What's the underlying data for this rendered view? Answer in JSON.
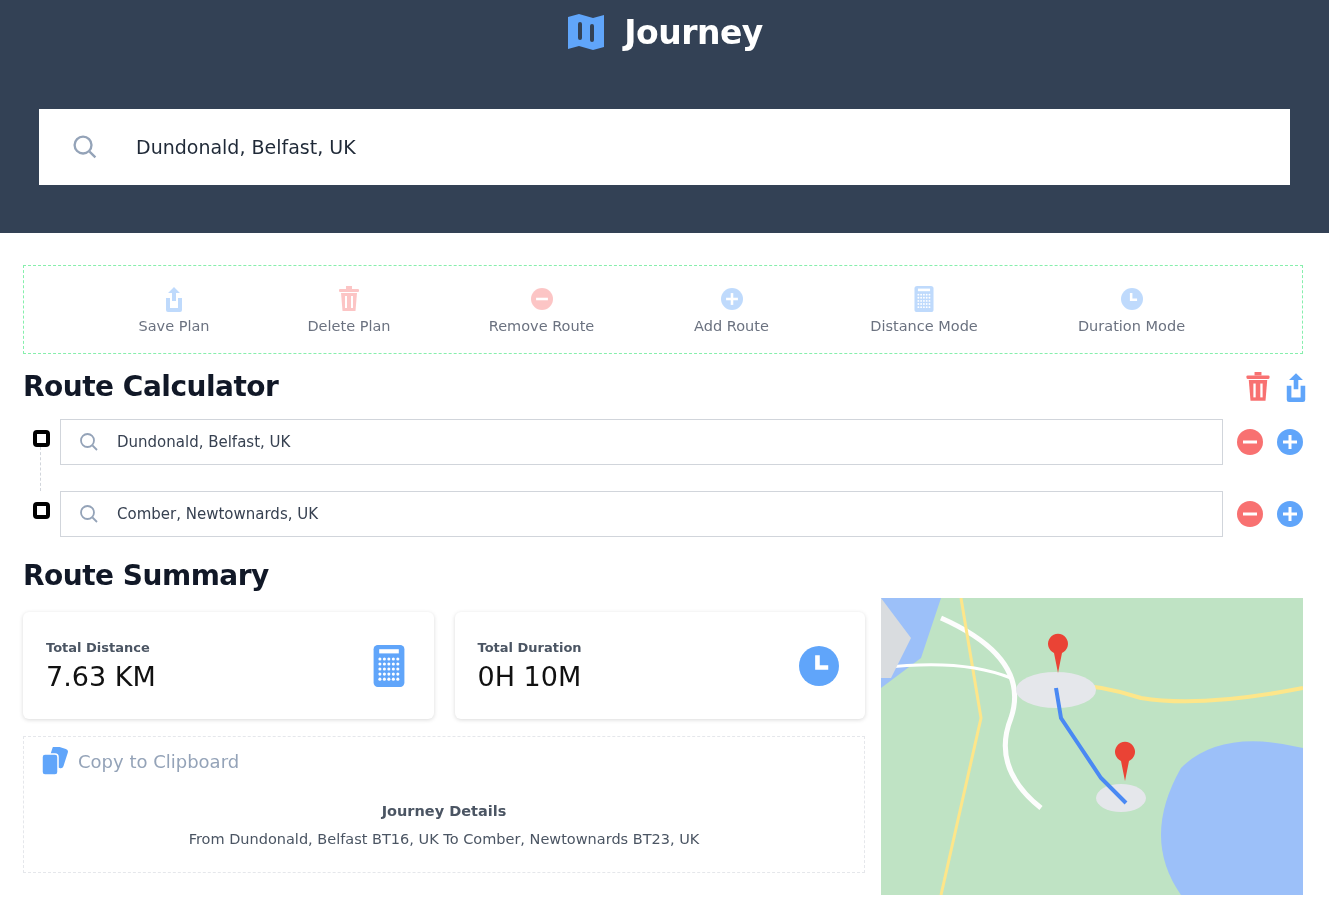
{
  "header": {
    "title": "Journey",
    "search": {
      "value": "Dundonald, Belfast, UK"
    }
  },
  "toolbar": [
    {
      "label": "Save Plan",
      "kind": "share",
      "disabled": true
    },
    {
      "label": "Delete Plan",
      "kind": "trash",
      "disabled": true
    },
    {
      "label": "Remove Route",
      "kind": "minus",
      "disabled": true
    },
    {
      "label": "Add Route",
      "kind": "plus",
      "disabled": true
    },
    {
      "label": "Distance Mode",
      "kind": "calculator",
      "disabled": true
    },
    {
      "label": "Duration Mode",
      "kind": "clock",
      "disabled": true
    }
  ],
  "route_calculator": {
    "title": "Route Calculator",
    "stops": [
      {
        "value": "Dundonald, Belfast, UK"
      },
      {
        "value": "Comber, Newtownards, UK"
      }
    ]
  },
  "route_summary": {
    "title": "Route Summary",
    "cards": [
      {
        "label": "Total Distance",
        "value": "7.63 KM",
        "kind": "calculator"
      },
      {
        "label": "Total Duration",
        "value": "0H 10M",
        "kind": "clock"
      }
    ],
    "clipboard": {
      "label": "Copy to Clipboard",
      "details_title": "Journey Details",
      "details": "From Dundonald, Belfast BT16, UK To Comber, Newtownards BT23, UK"
    }
  }
}
